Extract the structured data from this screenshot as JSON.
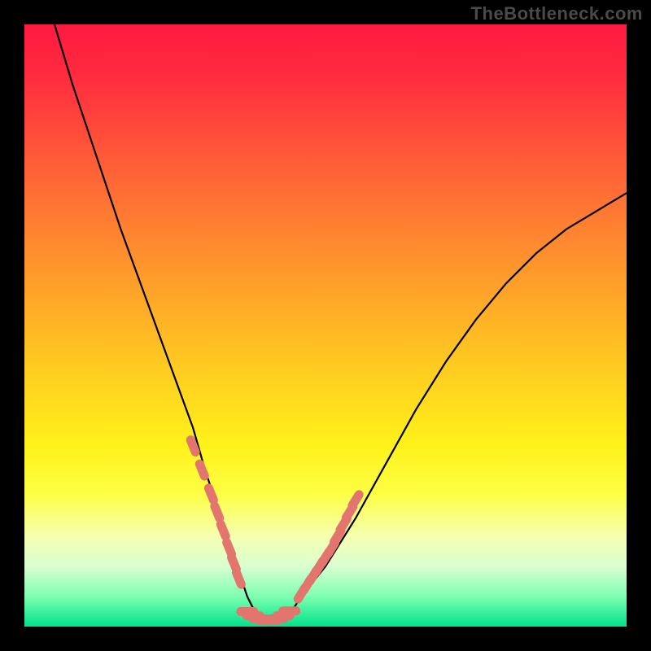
{
  "attribution": "TheBottleneck.com",
  "colors": {
    "frame": "#000000",
    "grad_top": "#ff1a42",
    "grad_mid_orange": "#ff8f2e",
    "grad_mid_yellow": "#fff21a",
    "grad_bottom": "#00e28a",
    "curve": "#000000",
    "marker": "#e2766e"
  },
  "chart_data": {
    "type": "line",
    "title": "",
    "xlabel": "",
    "ylabel": "",
    "xlim": [
      0,
      100
    ],
    "ylim": [
      0,
      100
    ],
    "series": [
      {
        "name": "curve",
        "x": [
          5,
          8,
          12,
          16,
          20,
          24,
          28,
          30,
          32,
          34,
          36,
          37,
          38,
          40,
          42,
          44,
          46,
          50,
          55,
          60,
          65,
          70,
          75,
          80,
          85,
          90,
          95,
          100
        ],
        "y": [
          100,
          90,
          78,
          66,
          55,
          44,
          33,
          26,
          20,
          14,
          8,
          5,
          3,
          1,
          1,
          2,
          5,
          10,
          18,
          27,
          36,
          44,
          51,
          57,
          62,
          66,
          69,
          72
        ]
      },
      {
        "name": "markers-left",
        "x": [
          28,
          29.5,
          31,
          32,
          33,
          34,
          34.8,
          35.6
        ],
        "y": [
          30,
          26,
          22,
          19,
          16,
          13,
          10.5,
          8
        ]
      },
      {
        "name": "markers-bottom",
        "x": [
          37,
          38,
          39,
          40,
          41,
          42,
          43,
          44
        ],
        "y": [
          2.5,
          1.8,
          1.3,
          1.0,
          1.0,
          1.3,
          1.8,
          2.6
        ]
      },
      {
        "name": "markers-right",
        "x": [
          46,
          47,
          48,
          49,
          50,
          51,
          52,
          53,
          54,
          55
        ],
        "y": [
          5.5,
          7,
          8.5,
          10,
          11.5,
          13,
          15,
          17,
          19,
          21
        ]
      }
    ]
  }
}
